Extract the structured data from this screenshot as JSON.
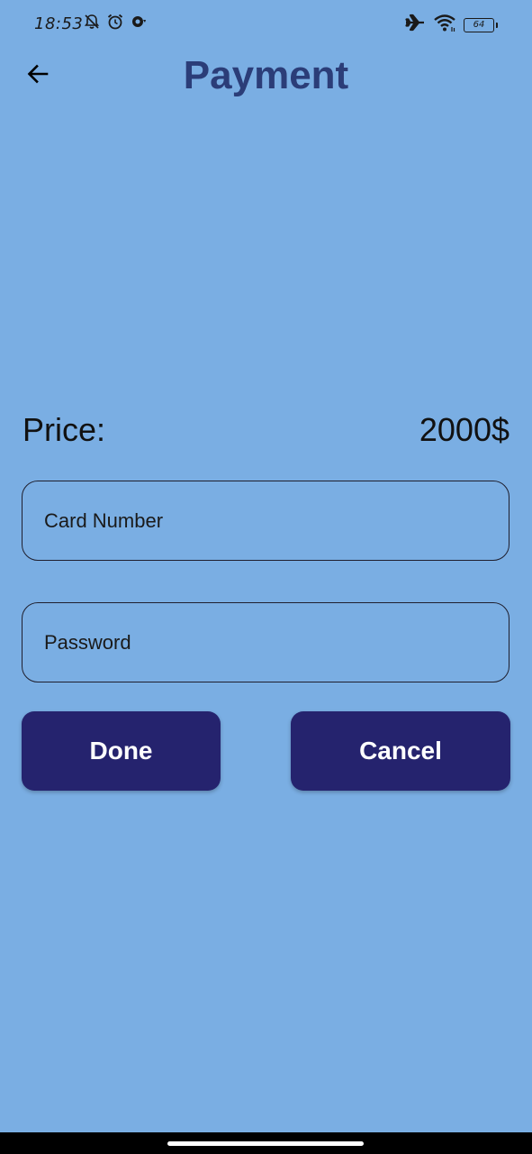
{
  "status_bar": {
    "time": "18:53",
    "battery": "64",
    "left_icons": [
      "bell-off-icon",
      "alarm-icon",
      "sync-icon"
    ],
    "right_icons": [
      "airplane-icon",
      "wifi-icon",
      "battery-icon"
    ]
  },
  "app_bar": {
    "title": "Payment",
    "back_icon": "arrow-left-icon"
  },
  "price": {
    "label": "Price:",
    "value": "2000$"
  },
  "form": {
    "card_number_placeholder": "Card Number",
    "card_number_value": "",
    "password_placeholder": "Password",
    "password_value": ""
  },
  "buttons": {
    "done": "Done",
    "cancel": "Cancel"
  },
  "colors": {
    "background": "#7aaee3",
    "title": "#2b3d78",
    "button": "#25236e",
    "button_text": "#ffffff",
    "border": "#1f1f2e"
  }
}
